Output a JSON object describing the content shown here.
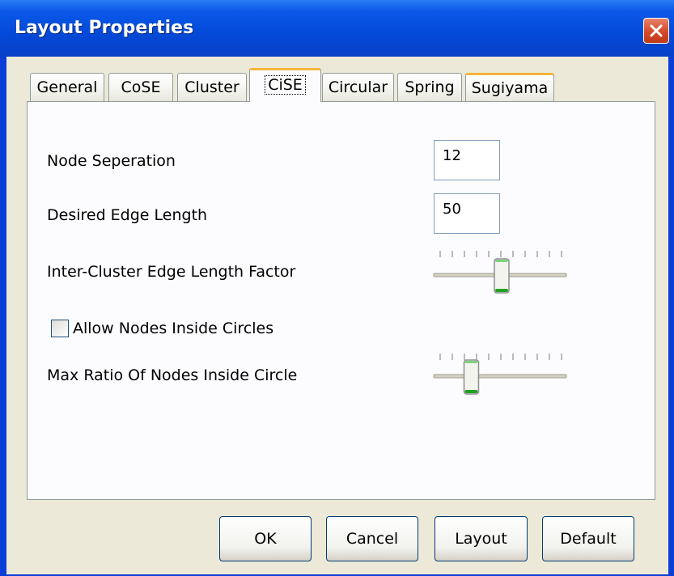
{
  "window": {
    "title": "Layout Properties"
  },
  "tabs": [
    {
      "label": "General"
    },
    {
      "label": "CoSE"
    },
    {
      "label": "Cluster"
    },
    {
      "label": "CiSE",
      "selected": true
    },
    {
      "label": "Circular"
    },
    {
      "label": "Spring"
    },
    {
      "label": "Sugiyama"
    }
  ],
  "settings": {
    "node_separation": {
      "label": "Node Seperation",
      "value": "12"
    },
    "desired_edge_length": {
      "label": "Desired Edge Length",
      "value": "50"
    },
    "inter_cluster_factor": {
      "label": "Inter-Cluster Edge Length Factor",
      "position": 0.5
    },
    "allow_nodes_inside": {
      "label": "Allow Nodes Inside Circles",
      "checked": false
    },
    "max_ratio_inside": {
      "label": "Max Ratio Of Nodes Inside Circle",
      "position": 0.25
    }
  },
  "buttons": {
    "ok": "OK",
    "cancel": "Cancel",
    "layout": "Layout",
    "default": "Default"
  },
  "colors": {
    "title_bar": "#0a58e8",
    "close_button": "#d4492a",
    "tab_highlight": "#f5b43a",
    "slider_thumb_accent": "#21a121"
  }
}
